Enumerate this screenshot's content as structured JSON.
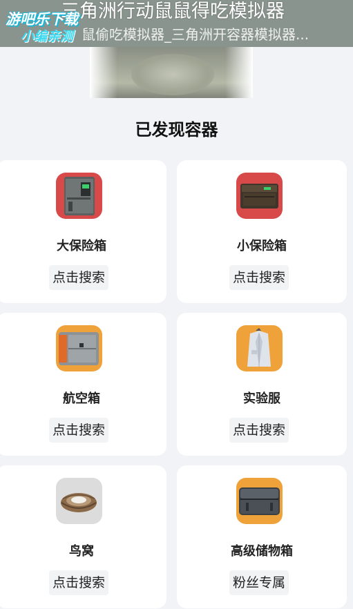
{
  "banner": {
    "title": "三角洲行动鼠鼠得吃模拟器",
    "subtitle": "鼠偷吃模拟器_三角洲开容器模拟器...",
    "watermark_line1": "游吧乐下载",
    "watermark_line2": "小编亲测"
  },
  "section_title": "已发现容器",
  "containers": [
    {
      "name": "大保险箱",
      "action": "点击搜索",
      "icon": "large-safe-icon",
      "icon_bg": "#d84a4a"
    },
    {
      "name": "小保险箱",
      "action": "点击搜索",
      "icon": "small-safe-icon",
      "icon_bg": "#d84a4a"
    },
    {
      "name": "航空箱",
      "action": "点击搜索",
      "icon": "flight-case-icon",
      "icon_bg": "#f0a23a"
    },
    {
      "name": "实验服",
      "action": "点击搜索",
      "icon": "lab-coat-icon",
      "icon_bg": "#f0a23a"
    },
    {
      "name": "鸟窝",
      "action": "点击搜索",
      "icon": "bird-nest-icon",
      "icon_bg": "#dcdcdc"
    },
    {
      "name": "高级储物箱",
      "action": "粉丝专属",
      "icon": "storage-box-icon",
      "icon_bg": "#f0a23a"
    }
  ]
}
